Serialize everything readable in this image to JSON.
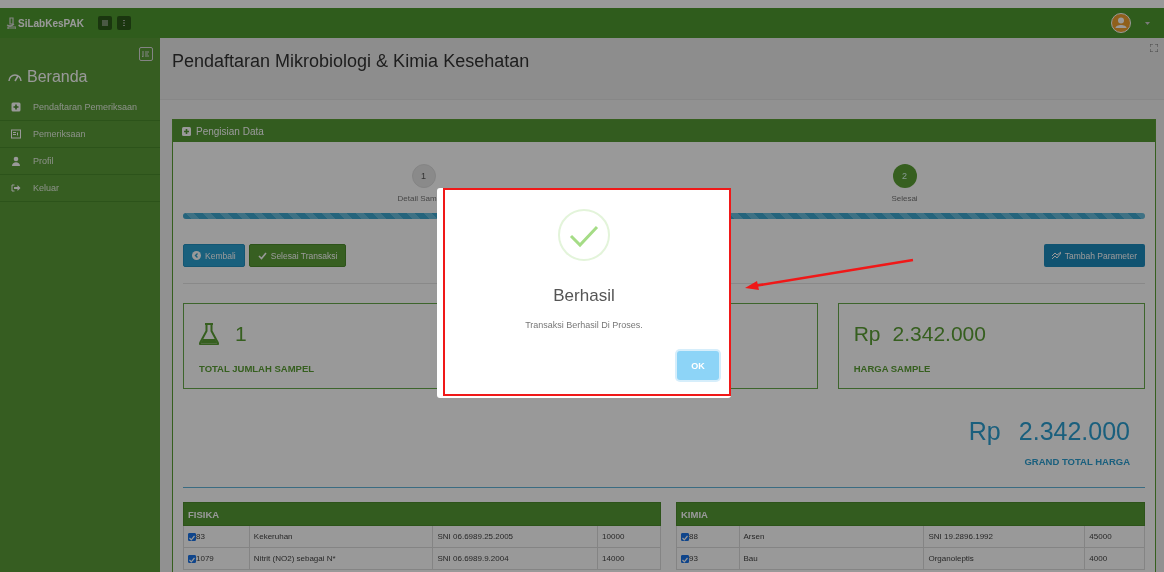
{
  "topbar": {
    "brand": "SiLabKesPAK"
  },
  "sidebar": {
    "home": "Beranda",
    "items": [
      {
        "label": "Pendaftaran Pemeriksaan",
        "kind": "plus"
      },
      {
        "label": "Pemeriksaan",
        "kind": "card"
      },
      {
        "label": "Profil",
        "kind": "user"
      },
      {
        "label": "Keluar",
        "kind": "exit"
      }
    ]
  },
  "page_title": "Pendaftaran Mikrobiologi & Kimia Kesehatan",
  "panel": {
    "title": "Pengisian Data",
    "steps": [
      {
        "number": "1",
        "label": "Detail Sam",
        "active": false
      },
      {
        "number": "2",
        "label": "Selesai",
        "active": true
      }
    ],
    "progress": {
      "level": 1
    },
    "buttons": [
      {
        "label": "Kembali",
        "kind": "back"
      },
      {
        "label": "Selesai Transaksi",
        "kind": "finish"
      },
      {
        "label": "Tambah Parameter",
        "kind": "add"
      }
    ],
    "stats": [
      {
        "kind": "count",
        "value": "1",
        "label": "TOTAL JUMLAH SAMPEL"
      },
      {
        "kind": "blank"
      },
      {
        "kind": "price",
        "currency": "Rp",
        "value": "2.342.000",
        "label": "HARGA SAMPLE"
      }
    ],
    "grand_total": {
      "currency": "Rp",
      "value": "2.342.000",
      "label": "GRAND TOTAL HARGA"
    },
    "tables": [
      {
        "title": "FISIKA",
        "rows": [
          {
            "checked": true,
            "id": "83",
            "name": "Kekeruhan",
            "method": "SNI 06.6989.25.2005",
            "price": "10000"
          },
          {
            "checked": true,
            "id": "1079",
            "name": "Nitrit (NO2) sebagai N*",
            "method": "SNI 06.6989.9.2004",
            "price": "14000"
          }
        ]
      },
      {
        "title": "KIMIA",
        "rows": [
          {
            "checked": true,
            "id": "88",
            "name": "Arsen",
            "method": "SNI 19.2896.1992",
            "price": "45000"
          },
          {
            "checked": true,
            "id": "93",
            "name": "Bau",
            "method": "Organoleptis",
            "price": "4000"
          }
        ]
      }
    ]
  },
  "dialog": {
    "title": "Berhasil",
    "message": "Transaksi Berhasil Di Proses.",
    "button": "OK"
  }
}
